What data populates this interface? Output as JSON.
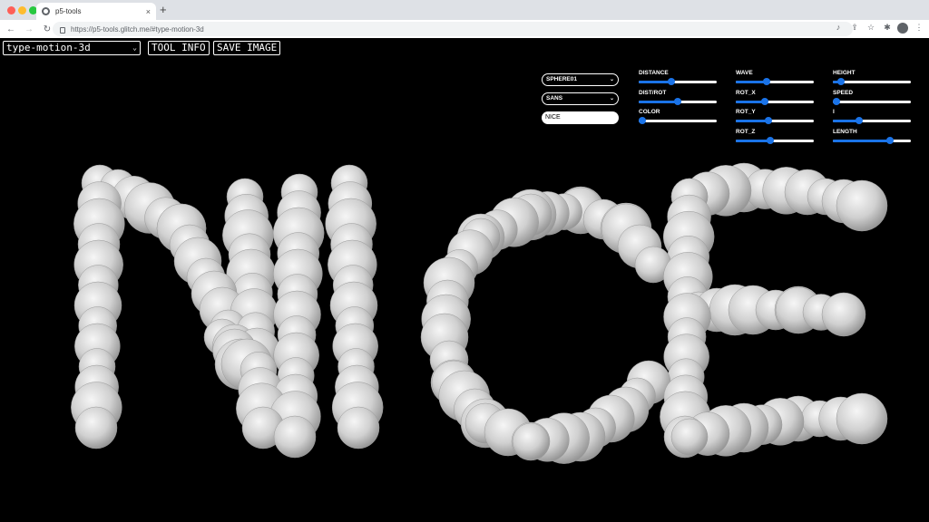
{
  "browser": {
    "tab_title": "p5-tools",
    "tab_close": "×",
    "new_tab": "+",
    "url": "https://p5-tools.glitch.me/#type-motion-3d",
    "traffic_colors": [
      "#ff5f57",
      "#febc2e",
      "#28c840"
    ]
  },
  "toolbar": {
    "tool_select": "type-motion-3d",
    "tool_info_label": "TOOL INFO",
    "save_image_label": "SAVE IMAGE"
  },
  "controls": {
    "shape_select": "SPHERE01",
    "font_select": "SANS",
    "text_value": "NICE",
    "sliders": [
      {
        "key": "distance",
        "label": "DISTANCE",
        "value": 0.42
      },
      {
        "key": "dist_rot",
        "label": "DIST/ROT",
        "value": 0.5
      },
      {
        "key": "color",
        "label": "COLOR",
        "value": 0.0
      },
      {
        "key": "wave",
        "label": "WAVE",
        "value": 0.4
      },
      {
        "key": "rot_x",
        "label": "ROT_X",
        "value": 0.37
      },
      {
        "key": "rot_y",
        "label": "ROT_Y",
        "value": 0.42
      },
      {
        "key": "rot_z",
        "label": "ROT_Z",
        "value": 0.44
      },
      {
        "key": "height",
        "label": "HEIGHT",
        "value": 0.1
      },
      {
        "key": "speed",
        "label": "SPEED",
        "value": 0.0
      },
      {
        "key": "i",
        "label": "I",
        "value": 0.34
      },
      {
        "key": "length",
        "label": "LENGTH",
        "value": 0.73
      }
    ],
    "accent": "#1a73e8"
  },
  "artwork": {
    "text": "NICE",
    "sphere_color": "#d6d6d6"
  }
}
